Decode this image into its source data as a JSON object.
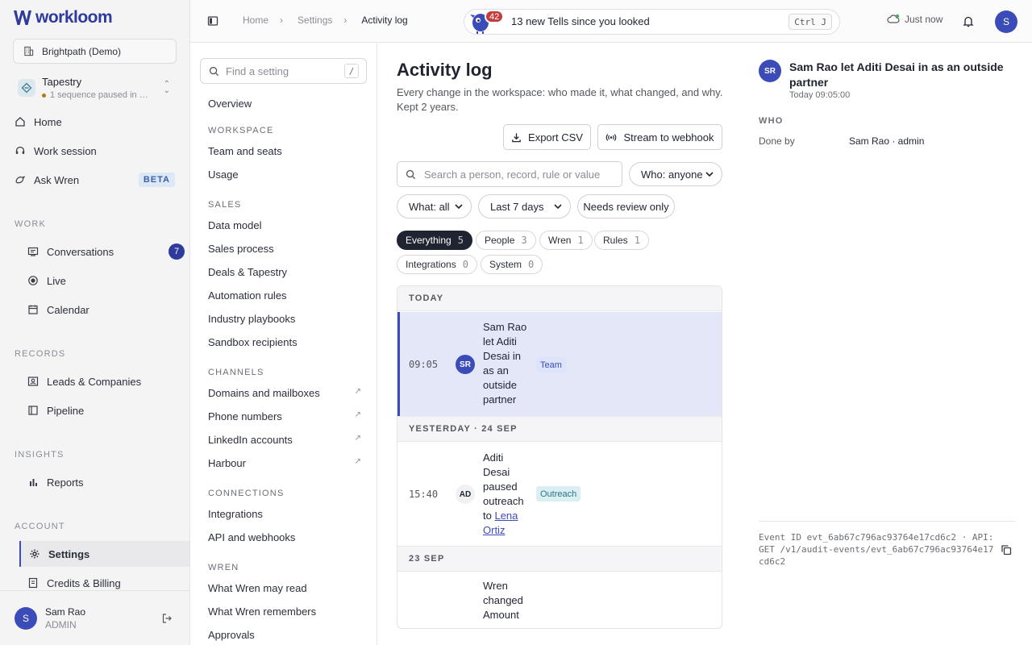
{
  "brand": {
    "name": "workloom"
  },
  "sidebar": {
    "workspace": "Brightpath (Demo)",
    "tapestry": {
      "title": "Tapestry",
      "subtitle": "1 sequence paused in …"
    },
    "top_items": [
      {
        "label": "Home",
        "icon": "home-icon"
      },
      {
        "label": "Work session",
        "icon": "headset-icon"
      },
      {
        "label": "Ask Wren",
        "icon": "bird-icon",
        "badge": "BETA"
      }
    ],
    "sections": {
      "work": "WORK",
      "records": "RECORDS",
      "insights": "INSIGHTS",
      "account": "ACCOUNT"
    },
    "work_items": [
      {
        "label": "Conversations",
        "count": "7"
      },
      {
        "label": "Live"
      },
      {
        "label": "Calendar"
      }
    ],
    "records_items": [
      {
        "label": "Leads & Companies"
      },
      {
        "label": "Pipeline"
      }
    ],
    "insights_items": [
      {
        "label": "Reports"
      }
    ],
    "account_items": [
      {
        "label": "Settings",
        "active": true
      },
      {
        "label": "Credits & Billing"
      }
    ],
    "user": {
      "initial": "S",
      "name": "Sam Rao",
      "role": "ADMIN"
    }
  },
  "topbar": {
    "breadcrumbs": [
      "Home",
      "Settings",
      "Activity log"
    ],
    "tells": {
      "count": "42",
      "text": "13 new Tells since you looked",
      "shortcut": "Ctrl J"
    },
    "sync_status": "Just now",
    "avatar_initial": "S"
  },
  "settings_nav": {
    "search_placeholder": "Find a setting",
    "search_shortcut": "/",
    "overview": "Overview",
    "workspace_label": "WORKSPACE",
    "workspace_items": [
      "Team and seats",
      "Usage"
    ],
    "sales_label": "SALES",
    "sales_items": [
      "Data model",
      "Sales process",
      "Deals & Tapestry",
      "Automation rules",
      "Industry playbooks",
      "Sandbox recipients"
    ],
    "channels_label": "CHANNELS",
    "channels_items": [
      "Domains and mailboxes",
      "Phone numbers",
      "LinkedIn accounts",
      "Harbour"
    ],
    "connections_label": "CONNECTIONS",
    "connections_items": [
      "Integrations",
      "API and webhooks"
    ],
    "wren_label": "WREN",
    "wren_items": [
      "What Wren may read",
      "What Wren remembers",
      "Approvals"
    ]
  },
  "activity": {
    "title": "Activity log",
    "description": "Every change in the workspace: who made it, what changed, and why. Kept 2 years.",
    "export_label": "Export CSV",
    "stream_label": "Stream to webhook",
    "search_placeholder": "Search a person, record, rule or value",
    "who_filter": "Who: anyone",
    "what_filter": "What: all",
    "range_filter": "Last 7 days",
    "review_toggle": "Needs review only",
    "pills": [
      {
        "label": "Everything",
        "count": "5",
        "active": true
      },
      {
        "label": "People",
        "count": "3"
      },
      {
        "label": "Wren",
        "count": "1"
      },
      {
        "label": "Rules",
        "count": "1"
      },
      {
        "label": "Integrations",
        "count": "0"
      },
      {
        "label": "System",
        "count": "0"
      }
    ],
    "days": [
      "TODAY",
      "YESTERDAY · 24 SEP",
      "23 SEP"
    ],
    "events": [
      {
        "time": "09:05",
        "initials": "SR",
        "text": "Sam Rao let Aditi Desai in as an outside partner",
        "tag": "Team"
      },
      {
        "time": "15:40",
        "initials": "AD",
        "text_before": "Aditi Desai paused outreach to ",
        "link": "Lena Ortiz",
        "tag": "Outreach"
      },
      {
        "time": "",
        "initials": "",
        "text": "Wren changed Amount"
      }
    ]
  },
  "detail": {
    "initials": "SR",
    "title": "Sam Rao let Aditi Desai in as an outside partner",
    "time": "Today 09:05:00",
    "who_label": "WHO",
    "done_by_label": "Done by",
    "done_by_value": "Sam Rao · admin",
    "event_line": "Event ID evt_6ab67c796ac93764e17cd6c2 · API: GET /v1/audit-events/evt_6ab67c796ac93764e17cd6c2"
  },
  "colors": {
    "accent": "#3b4bb8",
    "brand": "#2e3a9c",
    "badge_red": "#c23d3d",
    "team_tag": "#dde3f8",
    "outreach_tag": "#dbeff3"
  }
}
